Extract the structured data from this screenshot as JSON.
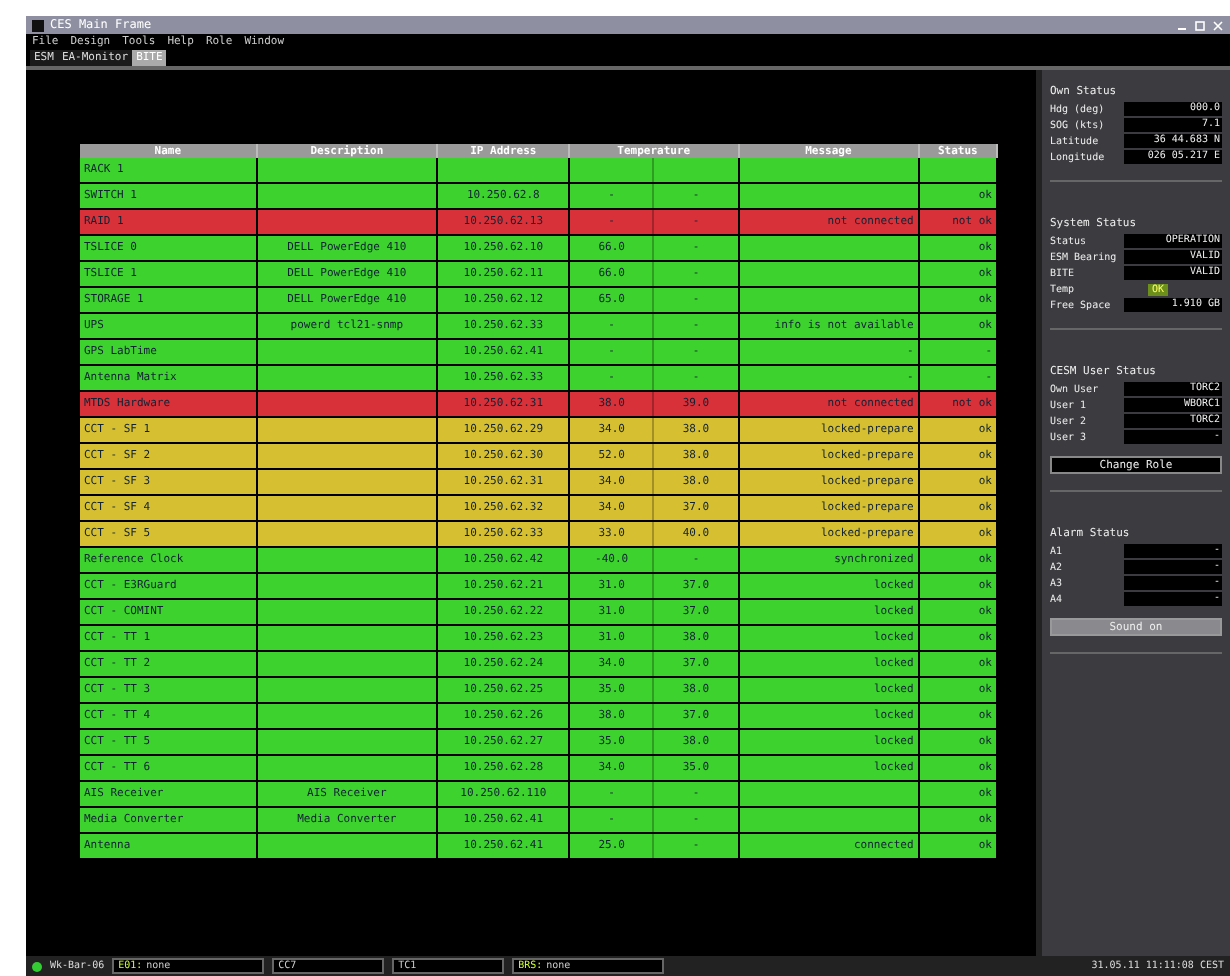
{
  "window": {
    "title": "CES Main Frame"
  },
  "menu": [
    "File",
    "Design",
    "Tools",
    "Help",
    "Role",
    "Window"
  ],
  "tabs": [
    {
      "label": "ESM",
      "selected": false
    },
    {
      "label": "EA-Monitor",
      "selected": false
    },
    {
      "label": "BITE",
      "selected": true
    }
  ],
  "table": {
    "columns": [
      "Name",
      "Description",
      "IP Address",
      "Temperature",
      "Message",
      "Status"
    ],
    "rows": [
      {
        "color": "#3ed22e",
        "name": "RACK 1"
      },
      {
        "color": "#3ed22e",
        "name": "SWITCH 1",
        "ip": "10.250.62.8",
        "temp_1": "-",
        "temp_2": "-",
        "status": "ok"
      },
      {
        "color": "#d8313a",
        "name": "RAID 1",
        "ip": "10.250.62.13",
        "temp_1": "-",
        "temp_2": "-",
        "message": "not connected",
        "status": "not ok"
      },
      {
        "color": "#3ed22e",
        "name": "TSLICE 0",
        "description": "DELL PowerEdge 410",
        "ip": "10.250.62.10",
        "temp_1": "66.0",
        "temp_2": "-",
        "status": "ok"
      },
      {
        "color": "#3ed22e",
        "name": "TSLICE 1",
        "description": "DELL PowerEdge 410",
        "ip": "10.250.62.11",
        "temp_1": "66.0",
        "temp_2": "-",
        "status": "ok"
      },
      {
        "color": "#3ed22e",
        "name": "STORAGE 1",
        "description": "DELL PowerEdge 410",
        "ip": "10.250.62.12",
        "temp_1": "65.0",
        "temp_2": "-",
        "status": "ok"
      },
      {
        "color": "#3ed22e",
        "name": "UPS",
        "description": "powerd tcl21-snmp",
        "ip": "10.250.62.33",
        "temp_1": "-",
        "temp_2": "-",
        "message": "info is not available",
        "status": "ok"
      },
      {
        "color": "#3ed22e",
        "name": "GPS LabTime",
        "ip": "10.250.62.41",
        "temp_1": "-",
        "temp_2": "-",
        "message": "-",
        "status": "-"
      },
      {
        "color": "#3ed22e",
        "name": "Antenna Matrix",
        "ip": "10.250.62.33",
        "temp_1": "-",
        "temp_2": "-",
        "message": "-",
        "status": "-"
      },
      {
        "color": "#d8313a",
        "name": "MTDS Hardware",
        "ip": "10.250.62.31",
        "temp_1": "38.0",
        "temp_2": "39.0",
        "message": "not connected",
        "status": "not ok"
      },
      {
        "color": "#d6c032",
        "name": "CCT - SF 1",
        "ip": "10.250.62.29",
        "temp_1": "34.0",
        "temp_2": "38.0",
        "message": "locked-prepare",
        "status": "ok"
      },
      {
        "color": "#d6c032",
        "name": "CCT - SF 2",
        "ip": "10.250.62.30",
        "temp_1": "52.0",
        "temp_2": "38.0",
        "message": "locked-prepare",
        "status": "ok"
      },
      {
        "color": "#d6c032",
        "name": "CCT - SF 3",
        "ip": "10.250.62.31",
        "temp_1": "34.0",
        "temp_2": "38.0",
        "message": "locked-prepare",
        "status": "ok"
      },
      {
        "color": "#d6c032",
        "name": "CCT - SF 4",
        "ip": "10.250.62.32",
        "temp_1": "34.0",
        "temp_2": "37.0",
        "message": "locked-prepare",
        "status": "ok"
      },
      {
        "color": "#d6c032",
        "name": "CCT - SF 5",
        "ip": "10.250.62.33",
        "temp_1": "33.0",
        "temp_2": "40.0",
        "message": "locked-prepare",
        "status": "ok"
      },
      {
        "color": "#3ed22e",
        "name": "Reference Clock",
        "ip": "10.250.62.42",
        "temp_1": "-40.0",
        "temp_2": "-",
        "message": "synchronized",
        "status": "ok"
      },
      {
        "color": "#3ed22e",
        "name": "CCT - E3RGuard",
        "ip": "10.250.62.21",
        "temp_1": "31.0",
        "temp_2": "37.0",
        "message": "locked",
        "status": "ok"
      },
      {
        "color": "#3ed22e",
        "name": "CCT - COMINT",
        "ip": "10.250.62.22",
        "temp_1": "31.0",
        "temp_2": "37.0",
        "message": "locked",
        "status": "ok"
      },
      {
        "color": "#3ed22e",
        "name": "CCT - TT 1",
        "ip": "10.250.62.23",
        "temp_1": "31.0",
        "temp_2": "38.0",
        "message": "locked",
        "status": "ok"
      },
      {
        "color": "#3ed22e",
        "name": "CCT - TT 2",
        "ip": "10.250.62.24",
        "temp_1": "34.0",
        "temp_2": "37.0",
        "message": "locked",
        "status": "ok"
      },
      {
        "color": "#3ed22e",
        "name": "CCT - TT 3",
        "ip": "10.250.62.25",
        "temp_1": "35.0",
        "temp_2": "38.0",
        "message": "locked",
        "status": "ok"
      },
      {
        "color": "#3ed22e",
        "name": "CCT - TT 4",
        "ip": "10.250.62.26",
        "temp_1": "38.0",
        "temp_2": "37.0",
        "message": "locked",
        "status": "ok"
      },
      {
        "color": "#3ed22e",
        "name": "CCT - TT 5",
        "ip": "10.250.62.27",
        "temp_1": "35.0",
        "temp_2": "38.0",
        "message": "locked",
        "status": "ok"
      },
      {
        "color": "#3ed22e",
        "name": "CCT - TT 6",
        "ip": "10.250.62.28",
        "temp_1": "34.0",
        "temp_2": "35.0",
        "message": "locked",
        "status": "ok"
      },
      {
        "color": "#3ed22e",
        "name": "AIS Receiver",
        "description": "AIS Receiver",
        "ip": "10.250.62.110",
        "temp_1": "-",
        "temp_2": "-",
        "status": "ok"
      },
      {
        "color": "#3ed22e",
        "name": "Media Converter",
        "description": "Media Converter",
        "ip": "10.250.62.41",
        "temp_1": "-",
        "temp_2": "-",
        "status": "ok"
      },
      {
        "color": "#3ed22e",
        "name": "Antenna",
        "ip": "10.250.62.41",
        "temp_1": "25.0",
        "temp_2": "-",
        "message": "connected",
        "status": "ok"
      }
    ]
  },
  "side_panel": [
    {
      "title": "Own Status",
      "fields": [
        {
          "kind": "value",
          "label": "Hdg (deg)",
          "value": "000.0"
        },
        {
          "kind": "value",
          "label": "SOG (kts)",
          "value": "7.1"
        },
        {
          "kind": "value",
          "label": "Latitude",
          "value": "36 44.683 N"
        },
        {
          "kind": "value",
          "label": "Longitude",
          "value": "026 05.217 E"
        }
      ]
    },
    {
      "title": "System Status",
      "fields": [
        {
          "kind": "value",
          "label": "Status",
          "value": "OPERATION"
        },
        {
          "kind": "value",
          "label": "ESM Bearing",
          "value": "VALID"
        },
        {
          "kind": "value",
          "label": "BITE",
          "value": "VALID"
        },
        {
          "kind": "badge",
          "label": "Temp",
          "value": "OK"
        },
        {
          "kind": "value",
          "label": "Free Space",
          "value": "1.910 GB"
        }
      ]
    },
    {
      "title": "CESM User Status",
      "fields": [
        {
          "kind": "value",
          "label": "Own User",
          "value": "TORC2"
        },
        {
          "kind": "value",
          "label": "User 1",
          "value": "WBORC1"
        },
        {
          "kind": "value",
          "label": "User 2",
          "value": "TORC2"
        },
        {
          "kind": "value",
          "label": "User 3",
          "value": "-"
        }
      ],
      "button": {
        "label": "Change Role",
        "kind": "dark"
      }
    },
    {
      "title": "Alarm Status",
      "fields": [
        {
          "kind": "value",
          "label": "A1",
          "value": "-"
        },
        {
          "kind": "value",
          "label": "A2",
          "value": "-"
        },
        {
          "kind": "value",
          "label": "A3",
          "value": "-"
        },
        {
          "kind": "value",
          "label": "A4",
          "value": "-"
        }
      ],
      "button": {
        "label": "Sound on",
        "kind": "light"
      }
    }
  ],
  "status_bar": [
    {
      "kind": "indicator",
      "label": "Wk-Bar-06"
    },
    {
      "kind": "field",
      "prefix": "E01:",
      "value": "none"
    },
    {
      "kind": "field",
      "value": "CC7"
    },
    {
      "kind": "field",
      "value": "TC1"
    },
    {
      "kind": "field",
      "prefix": "BRS:",
      "value": "none"
    },
    {
      "kind": "text",
      "value": "31.05.11 11:11:08 CEST"
    }
  ]
}
